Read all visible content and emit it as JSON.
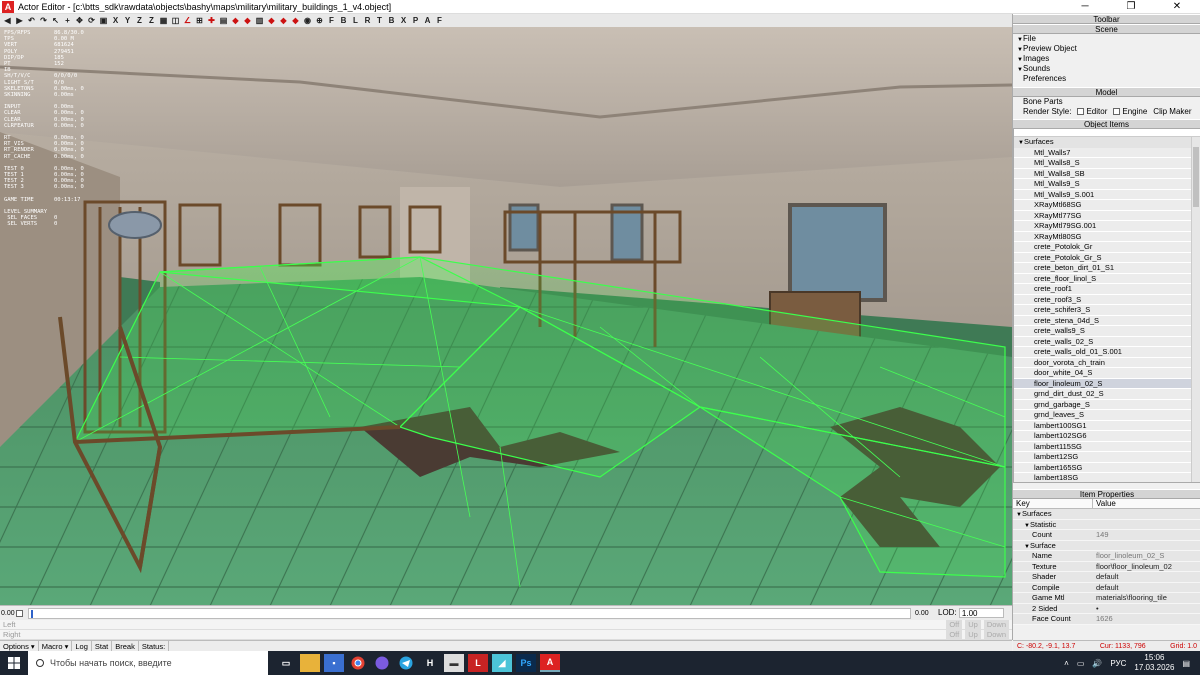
{
  "window": {
    "app_icon": "A",
    "title": "Actor Editor - [c:\\btts_sdk\\rawdata\\objects\\bashy\\maps\\military\\military_buildings_1_v4.object]",
    "minimize": "─",
    "maximize": "❐",
    "close": "✕"
  },
  "toolbar": {
    "letters": [
      "F",
      "B",
      "L",
      "R",
      "T",
      "B",
      "X",
      "P",
      "A",
      "F"
    ],
    "tools": [
      "X",
      "Y",
      "Z",
      "Z"
    ]
  },
  "stats": {
    "rows": [
      {
        "k": "FPS/RFPS",
        "v": "86.8/30.0"
      },
      {
        "k": "TPS",
        "v": "0.00 M"
      },
      {
        "k": "VERT",
        "v": "681624"
      },
      {
        "k": "POLY",
        "v": "279451"
      },
      {
        "k": "DIP/DP",
        "v": "185"
      },
      {
        "k": "PT",
        "v": "152"
      },
      {
        "k": "IB",
        "v": ""
      },
      {
        "k": "SH/T/V/C",
        "v": "0/0/0/0"
      },
      {
        "k": "LIGHT S/T",
        "v": "0/0"
      },
      {
        "k": "SKELETONS",
        "v": "0.00ms, 0"
      },
      {
        "k": "SKINNING",
        "v": "0.00ms"
      },
      {
        "k": "INPUT",
        "v": "0.00ms"
      },
      {
        "k": "CLEAR",
        "v": "0.00ms, 0"
      },
      {
        "k": "CLEAR",
        "v": "0.00ms, 0"
      },
      {
        "k": "CLRFEATUR",
        "v": "0.00ms, 0"
      },
      {
        "k": "RT",
        "v": "0.00ms, 0"
      },
      {
        "k": "RT_VIS",
        "v": "0.00ms, 0"
      },
      {
        "k": "RT_RENDER",
        "v": "0.00ms, 0"
      },
      {
        "k": "RT_CACHE",
        "v": "0.00ms, 0"
      },
      {
        "k": "TEST 0",
        "v": "0.00ms, 0"
      },
      {
        "k": "TEST 1",
        "v": "0.00ms, 0"
      },
      {
        "k": "TEST 2",
        "v": "0.00ms, 0"
      },
      {
        "k": "TEST 3",
        "v": "0.00ms, 0"
      },
      {
        "k": "GAME TIME",
        "v": "00:13:17"
      },
      {
        "k": "LEVEL SUMMARY",
        "v": ""
      },
      {
        "k": " SEL FACES",
        "v": "0"
      },
      {
        "k": " SEL VERTS",
        "v": "0"
      }
    ]
  },
  "panel": {
    "toolbar_header": "Toolbar",
    "scene_header": "Scene",
    "scene_items": [
      "File",
      "Preview Object",
      "Images",
      "Sounds"
    ],
    "preferences": "Preferences",
    "model_header": "Model",
    "bone_parts": "Bone Parts",
    "render_style_label": "Render Style:",
    "render_editor": "Editor",
    "render_engine": "Engine",
    "clip_maker": "Clip Maker",
    "object_items_header": "Object Items",
    "surfaces_group": "Surfaces",
    "surface_list": [
      "Mtl_Walls7",
      "Mtl_Walls8_S",
      "Mtl_Walls8_SB",
      "Mtl_Walls9_S",
      "Mtl_Walls9_S.001",
      "XRayMtl68SG",
      "XRayMtl77SG",
      "XRayMtl79SG.001",
      "XRayMtl80SG",
      "crete_Potolok_Gr",
      "crete_Potolok_Gr_S",
      "crete_beton_dirt_01_S1",
      "crete_floor_linol_S",
      "crete_roof1",
      "crete_roof3_S",
      "crete_schifer3_S",
      "crete_stena_04d_S",
      "crete_walls9_S",
      "crete_walls_02_S",
      "crete_walls_old_01_S.001",
      "door_vorota_ch_train",
      "door_white_04_S",
      "floor_linoleum_02_S",
      "grnd_dirt_dust_02_S",
      "grnd_garbage_S",
      "grnd_leaves_S",
      "lambert100SG1",
      "lambert102SG6",
      "lambert115SG",
      "lambert12SG",
      "lambert165SG",
      "lambert18SG"
    ],
    "selected_index": 22,
    "item_properties_header": "Item Properties",
    "col_key": "Key",
    "col_value": "Value",
    "props": [
      {
        "k": "Surfaces",
        "v": "",
        "indent": 0,
        "tri": true
      },
      {
        "k": "Statistic",
        "v": "",
        "indent": 1,
        "tri": true
      },
      {
        "k": "Count",
        "v": "149",
        "indent": 2
      },
      {
        "k": "Surface",
        "v": "",
        "indent": 1,
        "tri": true
      },
      {
        "k": "Name",
        "v": "floor_linoleum_02_S",
        "indent": 2
      },
      {
        "k": "Texture",
        "v": "floor\\floor_linoleum_02",
        "indent": 2,
        "dark": true
      },
      {
        "k": "Shader",
        "v": "default",
        "indent": 2,
        "dark": true
      },
      {
        "k": "Compile",
        "v": "default",
        "indent": 2,
        "dark": true
      },
      {
        "k": "Game Mtl",
        "v": "materials\\flooring_tile",
        "indent": 2,
        "dark": true
      },
      {
        "k": "2 Sided",
        "v": "•",
        "indent": 2,
        "dark": true
      },
      {
        "k": "Face Count",
        "v": "1626",
        "indent": 2
      }
    ],
    "coords": "C: -80.2, -9.1, 13.7",
    "cursor": "Cur: 1133, 796",
    "grid": "Grid: 1.0"
  },
  "timeline": {
    "left_val": "0.00",
    "right_val": "0.00",
    "lod_label": "LOD:",
    "lod_value": "1.00"
  },
  "log": {
    "left": "Left",
    "right": "Right",
    "btn_off": "Off",
    "btn_up": "Up",
    "btn_down": "Down"
  },
  "statusbar": {
    "items": [
      "Options ▾",
      "Macro ▾",
      "Log",
      "Stat",
      "Break",
      "Status:"
    ]
  },
  "taskbar": {
    "search_placeholder": "Чтобы начать поиск, введите",
    "lang": "РУС",
    "time": "15:06",
    "date": "17.03.2026"
  }
}
